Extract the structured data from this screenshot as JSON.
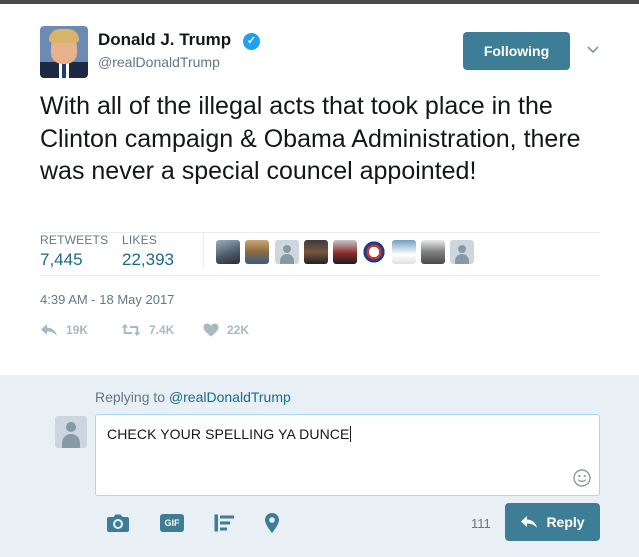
{
  "tweet": {
    "author_name": "Donald J. Trump",
    "author_handle": "@realDonaldTrump",
    "verified_icon": "verified-badge-icon",
    "follow_button_label": "Following",
    "text": "With all of the illegal acts that took place in the Clinton campaign & Obama Administration, there was never a special councel appointed!",
    "stats": {
      "retweets_label": "RETWEETS",
      "retweets_value": "7,445",
      "likes_label": "LIKES",
      "likes_value": "22,393"
    },
    "timestamp": "4:39 AM - 18 May 2017",
    "actions": {
      "reply_count": "19K",
      "retweet_count": "7.4K",
      "like_count": "22K"
    }
  },
  "reply": {
    "replying_to_prefix": "Replying to",
    "replying_to_handle": "@realDonaldTrump",
    "draft_text": "CHECK YOUR SPELLING YA DUNCE",
    "char_counter": "111",
    "reply_button_label": "Reply",
    "gif_label": "GIF"
  },
  "colors": {
    "accent": "#3d7d96",
    "link": "#1b6a8a",
    "muted": "#657786",
    "reply_background": "#e8f0f6"
  }
}
